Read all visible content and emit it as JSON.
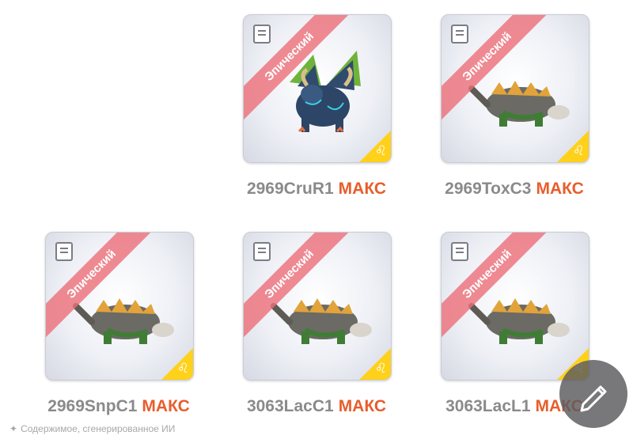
{
  "cards": [
    {
      "ribbon": "Эпический",
      "name": "2969CruR1",
      "max": "МАКС",
      "creature": "dark-blue-winged-dragon-icon",
      "corner": "leo-sign-icon"
    },
    {
      "ribbon": "Эпический",
      "name": "2969ToxC3",
      "max": "МАКС",
      "creature": "spiked-lizard-icon",
      "corner": "leo-sign-icon"
    },
    {
      "ribbon": "Эпический",
      "name": "2969SnpC1",
      "max": "МАКС",
      "creature": "spiked-lizard-icon",
      "corner": "leo-sign-icon"
    },
    {
      "ribbon": "Эпический",
      "name": "3063LacC1",
      "max": "МАКС",
      "creature": "spiked-lizard-icon",
      "corner": "leo-sign-icon"
    },
    {
      "ribbon": "Эпический",
      "name": "3063LacL1",
      "max": "МАКС",
      "creature": "spiked-lizard-icon",
      "corner": "leo-sign-icon"
    }
  ],
  "footer": {
    "text": "Содержимое, сгенерированное ИИ"
  },
  "corner_glyph": "♌",
  "colors": {
    "ribbon": "#ec6e78",
    "max": "#e85d2c",
    "name": "#8a8a8a",
    "corner": "#ffd11a",
    "fab": "#5a5a5e"
  }
}
